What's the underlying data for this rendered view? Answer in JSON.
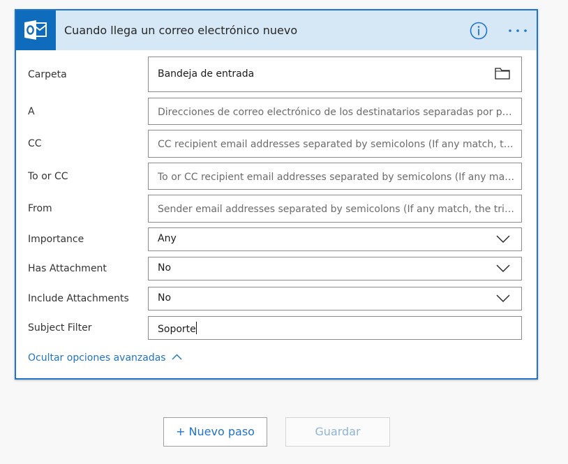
{
  "trigger": {
    "title": "Cuando llega un correo electrónico nuevo",
    "icons": {
      "app": "outlook-icon",
      "info": "info-icon",
      "more": "more-options-icon",
      "folder": "folder-icon",
      "dropdown": "chevron-down-icon",
      "collapse": "chevron-up-icon"
    },
    "accent_color": "#1f73c8",
    "fields": [
      {
        "label": "Carpeta",
        "value": "Bandeja de entrada",
        "placeholder": ""
      },
      {
        "label": "A",
        "value": "",
        "placeholder": "Direcciones de correo electrónico de los destinatarios separadas por punto y..."
      },
      {
        "label": "CC",
        "value": "",
        "placeholder": "CC recipient email addresses separated by semicolons (If any match, the trigg..."
      },
      {
        "label": "To or CC",
        "value": "",
        "placeholder": "To or CC recipient email addresses separated by semicolons (If any match, th..."
      },
      {
        "label": "From",
        "value": "",
        "placeholder": "Sender email addresses separated by semicolons (If any match, the trigger wi..."
      },
      {
        "label": "Importance",
        "value": "Any"
      },
      {
        "label": "Has Attachment",
        "value": "No"
      },
      {
        "label": "Include Attachments",
        "value": "No"
      },
      {
        "label": "Subject Filter",
        "value": "Soporte"
      }
    ],
    "advanced_link": "Ocultar opciones avanzadas"
  },
  "actions": {
    "new_step": "+ Nuevo paso",
    "save": "Guardar"
  }
}
